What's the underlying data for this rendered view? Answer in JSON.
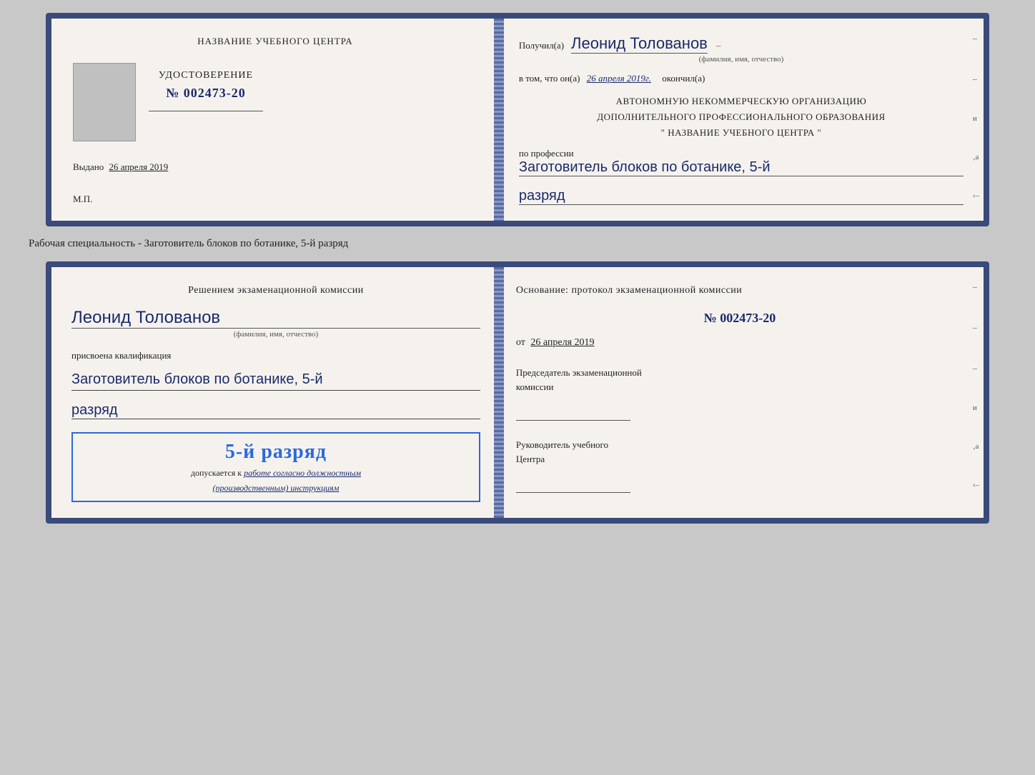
{
  "top_doc": {
    "left": {
      "title": "НАЗВАНИЕ УЧЕБНОГО ЦЕНТРА",
      "cert_label": "УДОСТОВЕРЕНИЕ",
      "cert_number": "№ 002473-20",
      "issued_label": "Выдано",
      "issued_date": "26 апреля 2019",
      "mp_label": "М.П."
    },
    "right": {
      "received_prefix": "Получил(а)",
      "received_name": "Леонид Толованов",
      "fio_label": "(фамилия, имя, отчество)",
      "in_that_prefix": "в том, что он(а)",
      "date_completed": "26 апреля 2019г.",
      "completed_suffix": "окончил(а)",
      "org_line1": "АВТОНОМНУЮ НЕКОММЕРЧЕСКУЮ ОРГАНИЗАЦИЮ",
      "org_line2": "ДОПОЛНИТЕЛЬНОГО ПРОФЕССИОНАЛЬНОГО ОБРАЗОВАНИЯ",
      "org_line3": "\"   НАЗВАНИЕ УЧЕБНОГО ЦЕНТРА   \"",
      "profession_label": "по профессии",
      "profession_value": "Заготовитель блоков по ботанике, 5-й",
      "rank_value": "разряд"
    }
  },
  "separator": {
    "text": "Рабочая специальность - Заготовитель блоков по ботанике, 5-й разряд"
  },
  "bottom_doc": {
    "left": {
      "commission_title": "Решением экзаменационной комиссии",
      "name": "Леонид Толованов",
      "fio_label": "(фамилия, имя, отчество)",
      "assigned_label": "присвоена квалификация",
      "profession_value": "Заготовитель блоков по ботанике, 5-й",
      "rank_value": "разряд",
      "stamp_rank": "5-й разряд",
      "stamp_allowed": "допускается к",
      "stamp_work": "работе согласно должностным",
      "stamp_instructions": "(производственным) инструкциям"
    },
    "right": {
      "basis_label": "Основание: протокол экзаменационной комиссии",
      "protocol_number": "№  002473-20",
      "from_prefix": "от",
      "from_date": "26 апреля 2019",
      "chairman_label": "Председатель экзаменационной",
      "chairman_label2": "комиссии",
      "director_label": "Руководитель учебного",
      "director_label2": "Центра"
    }
  }
}
